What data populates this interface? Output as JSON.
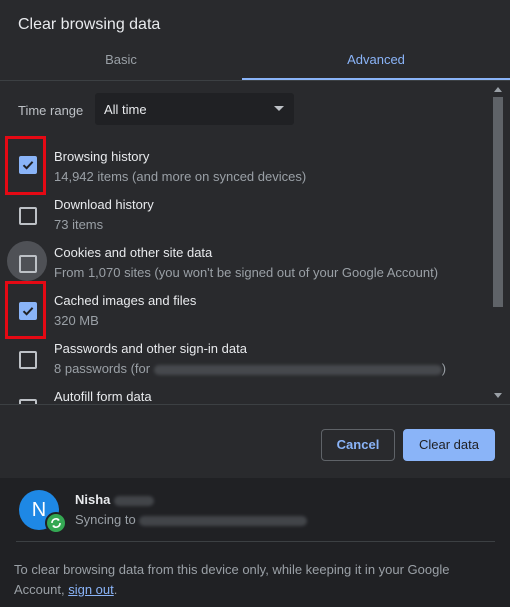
{
  "dialog": {
    "title": "Clear browsing data"
  },
  "tabs": [
    {
      "label": "Basic",
      "active": false
    },
    {
      "label": "Advanced",
      "active": true
    }
  ],
  "time_range": {
    "label": "Time range",
    "value": "All time"
  },
  "items": [
    {
      "title": "Browsing history",
      "subtitle": "14,942 items (and more on synced devices)",
      "checked": true
    },
    {
      "title": "Download history",
      "subtitle": "73 items",
      "checked": false
    },
    {
      "title": "Cookies and other site data",
      "subtitle": "From 1,070 sites (you won't be signed out of your Google Account)",
      "checked": false
    },
    {
      "title": "Cached images and files",
      "subtitle": "320 MB",
      "checked": true
    },
    {
      "title": "Passwords and other sign-in data",
      "subtitle_prefix": "8 passwords (for",
      "subtitle_suffix": ")",
      "checked": false
    },
    {
      "title": "Autofill form data",
      "checked": false
    }
  ],
  "buttons": {
    "cancel": "Cancel",
    "clear": "Clear data"
  },
  "account": {
    "avatar_letter": "N",
    "name": "Nisha",
    "sync_text": "Syncing to"
  },
  "footer": {
    "text": "To clear browsing data from this device only, while keeping it in your Google Account,",
    "link": "sign out",
    "end": "."
  },
  "colors": {
    "background": "#292a2d",
    "accent": "#8ab4f8",
    "highlight_box": "#e50914",
    "account_bg": "#202124",
    "avatar": "#1e88e5",
    "sync_badge": "#34a853"
  }
}
